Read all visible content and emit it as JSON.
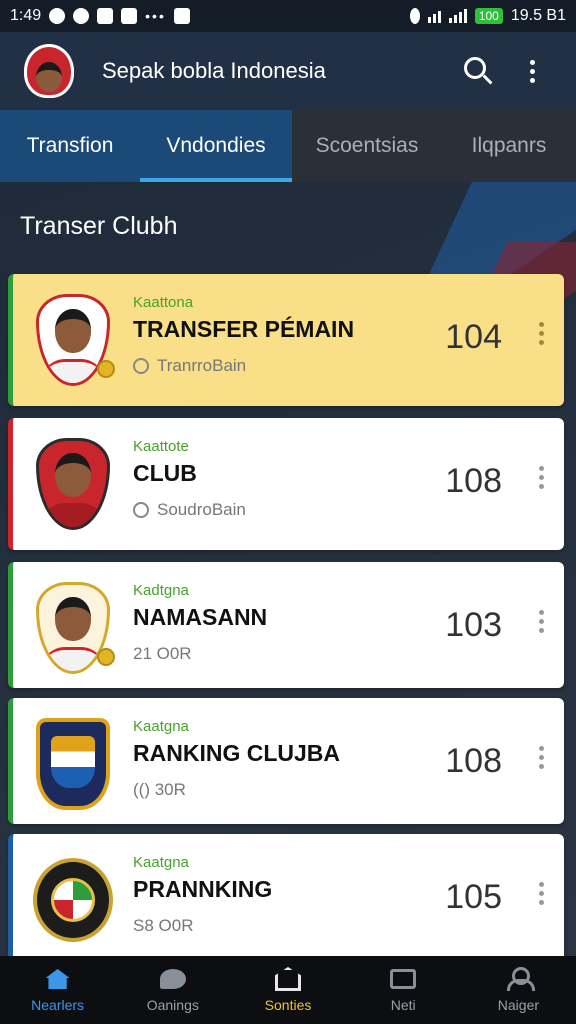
{
  "status_bar": {
    "time": "1:49",
    "battery": "100",
    "right_text": "19.5 B1"
  },
  "app_bar": {
    "title": "Sepak bobla Indonesia",
    "logo_icon": "team-crest-icon",
    "search_icon": "search-icon",
    "menu_icon": "more-vertical-icon"
  },
  "tabs": [
    {
      "label": "Transfion"
    },
    {
      "label": "Vndondies"
    },
    {
      "label": "Scoentsias"
    },
    {
      "label": "Ilqpanrs"
    }
  ],
  "section": {
    "title": "Transer Clubh"
  },
  "cards": [
    {
      "category": "Kaattona",
      "title": "TRANSFER PÉMAIN",
      "subtitle": "TranrroBain",
      "value": "104"
    },
    {
      "category": "Kaattote",
      "title": "CLUB",
      "subtitle": "SoudroBain",
      "value": "108"
    },
    {
      "category": "Kadtgna",
      "title": "NAMASANN",
      "subtitle": "21 O0R",
      "value": "103"
    },
    {
      "category": "Kaatgna",
      "title": "RANKING CLUJBA",
      "subtitle": "(() 30R",
      "value": "108"
    },
    {
      "category": "Kaatgna",
      "title": "PRANNKING",
      "subtitle": "S8 O0R",
      "value": "105"
    }
  ],
  "bottom_nav": [
    {
      "label": "Nearlers",
      "icon": "home-icon"
    },
    {
      "label": "Oanings",
      "icon": "chat-icon"
    },
    {
      "label": "Sonties",
      "icon": "house-icon"
    },
    {
      "label": "Neti",
      "icon": "card-icon"
    },
    {
      "label": "Naiger",
      "icon": "user-icon"
    }
  ],
  "colors": {
    "app_bar": "#223046",
    "tab_active_indicator": "#38a8e8",
    "highlight_card": "#f9df88",
    "category_green": "#4aa02c",
    "nav_active": "#3d97e8",
    "nav_yellow": "#f0c13a"
  }
}
